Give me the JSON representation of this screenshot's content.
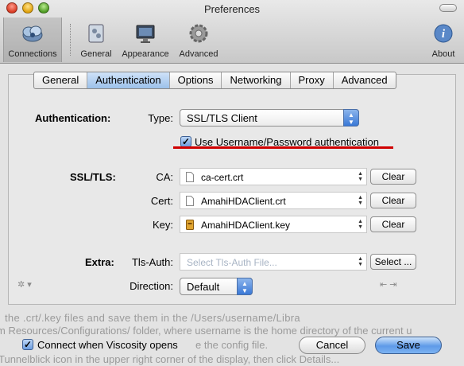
{
  "window": {
    "title": "Preferences"
  },
  "toolbar": {
    "items": [
      {
        "label": "Connections",
        "selected": true,
        "icon": "connections-icon"
      },
      {
        "label": "General",
        "icon": "general-icon"
      },
      {
        "label": "Appearance",
        "icon": "appearance-icon"
      },
      {
        "label": "Advanced",
        "icon": "gear-icon"
      },
      {
        "label": "About",
        "icon": "info-icon"
      }
    ]
  },
  "tabs": [
    {
      "label": "General"
    },
    {
      "label": "Authentication",
      "selected": true
    },
    {
      "label": "Options"
    },
    {
      "label": "Networking"
    },
    {
      "label": "Proxy"
    },
    {
      "label": "Advanced"
    }
  ],
  "authentication": {
    "section_label": "Authentication:",
    "type_label": "Type:",
    "type_value": "SSL/TLS Client",
    "use_password_label": "Use Username/Password authentication",
    "use_password_checked": true
  },
  "ssl_tls": {
    "section_label": "SSL/TLS:",
    "ca_label": "CA:",
    "ca_file": "ca-cert.crt",
    "cert_label": "Cert:",
    "cert_file": "AmahiHDAClient.crt",
    "key_label": "Key:",
    "key_file": "AmahiHDAClient.key",
    "clear_label": "Clear"
  },
  "extra": {
    "section_label": "Extra:",
    "tls_auth_label": "Tls-Auth:",
    "tls_auth_placeholder": "Select Tls-Auth File...",
    "select_label": "Select ...",
    "direction_label": "Direction:",
    "direction_value": "Default"
  },
  "footer": {
    "connect_on_open_label": "Connect when Viscosity opens",
    "connect_on_open_checked": true,
    "cancel_label": "Cancel",
    "save_label": "Save"
  },
  "background_text": {
    "line1": "the   .crt/.key   files   and   save   them   in   the   /Users/username/Libra",
    "line2": "m Resources/Configurations/ folder, where username is the home directory of the current u",
    "line3": "e the config file.",
    "line4": "Tunnelblick icon in the upper right corner of the display, then click Details..."
  },
  "colors": {
    "accent": "#5e9ae8",
    "annotation": "#d00000"
  }
}
